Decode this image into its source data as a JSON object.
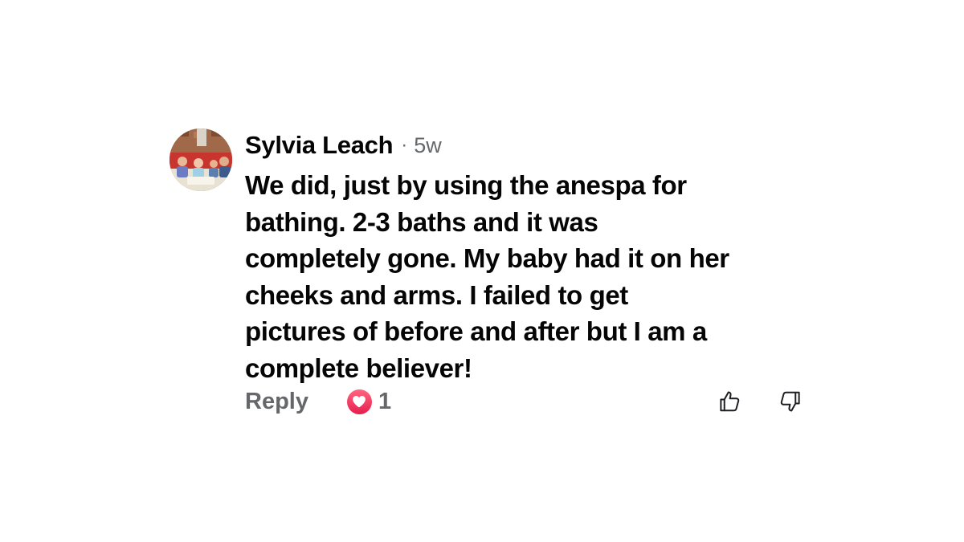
{
  "comment": {
    "author": "Sylvia Leach",
    "separator": "·",
    "timestamp": "5w",
    "text_lines": [
      "We did, just by using the anespa for",
      "bathing. 2-3 baths and it was",
      "completely gone. My baby had it on her",
      "cheeks and arms. I failed to get",
      "pictures of before and after but I am a",
      "complete believer!"
    ],
    "avatar_icon": "user-photo",
    "actions": {
      "reply_label": "Reply",
      "reaction_icon": "heart-icon",
      "reaction_count": "1",
      "like_icon": "thumbs-up-icon",
      "dislike_icon": "thumbs-down-icon"
    }
  },
  "colors": {
    "primary_text": "#050505",
    "secondary_text": "#65676b",
    "heart": "#e61e4d"
  }
}
